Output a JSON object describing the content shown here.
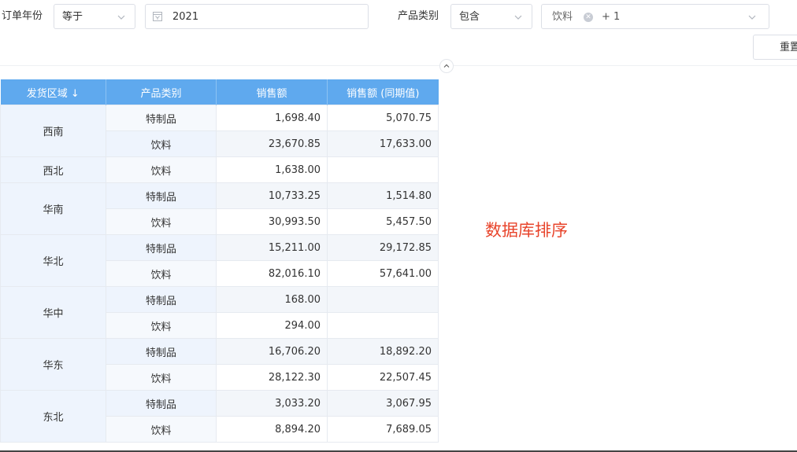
{
  "filters": {
    "year": {
      "label": "订单年份",
      "operator": "等于",
      "value": "2021"
    },
    "category": {
      "label": "产品类别",
      "operator": "包含",
      "tag": "饮料",
      "more": "+ 1"
    },
    "reset_label": "重置"
  },
  "table": {
    "headers": [
      "发货区域 ↓",
      "产品类别",
      "销售额",
      "销售额 (同期值)"
    ],
    "groups": [
      {
        "region": "西南",
        "rows": [
          {
            "category": "特制品",
            "sales": "1,698.40",
            "prior": "5,070.75"
          },
          {
            "category": "饮料",
            "sales": "23,670.85",
            "prior": "17,633.00"
          }
        ]
      },
      {
        "region": "西北",
        "rows": [
          {
            "category": "饮料",
            "sales": "1,638.00",
            "prior": ""
          }
        ]
      },
      {
        "region": "华南",
        "rows": [
          {
            "category": "特制品",
            "sales": "10,733.25",
            "prior": "1,514.80"
          },
          {
            "category": "饮料",
            "sales": "30,993.50",
            "prior": "5,457.50"
          }
        ]
      },
      {
        "region": "华北",
        "rows": [
          {
            "category": "特制品",
            "sales": "15,211.00",
            "prior": "29,172.85"
          },
          {
            "category": "饮料",
            "sales": "82,016.10",
            "prior": "57,641.00"
          }
        ]
      },
      {
        "region": "华中",
        "rows": [
          {
            "category": "特制品",
            "sales": "168.00",
            "prior": ""
          },
          {
            "category": "饮料",
            "sales": "294.00",
            "prior": ""
          }
        ]
      },
      {
        "region": "华东",
        "rows": [
          {
            "category": "特制品",
            "sales": "16,706.20",
            "prior": "18,892.20"
          },
          {
            "category": "饮料",
            "sales": "28,122.30",
            "prior": "22,507.45"
          }
        ]
      },
      {
        "region": "东北",
        "rows": [
          {
            "category": "特制品",
            "sales": "3,033.20",
            "prior": "3,067.95"
          },
          {
            "category": "饮料",
            "sales": "8,894.20",
            "prior": "7,689.05"
          }
        ]
      }
    ]
  },
  "annotation": "数据库排序",
  "colors": {
    "header_bg": "#5fa9ee",
    "annotation": "#e8442b",
    "region_bg": "#eef4fd"
  }
}
